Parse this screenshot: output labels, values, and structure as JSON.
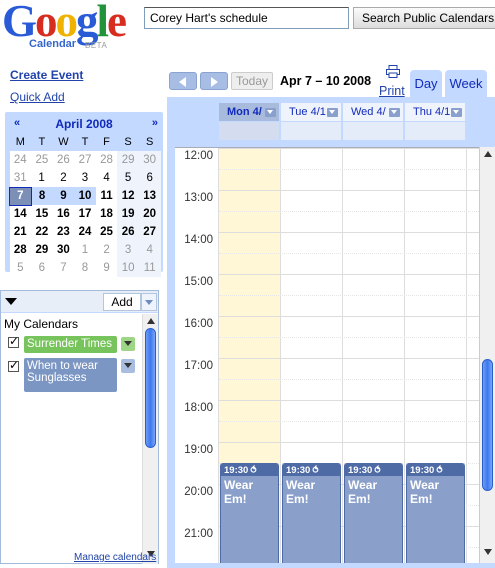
{
  "header": {
    "logo_letters": [
      {
        "ch": "G",
        "color": "#2a5bd7"
      },
      {
        "ch": "o",
        "color": "#d62d20"
      },
      {
        "ch": "o",
        "color": "#f0b200"
      },
      {
        "ch": "g",
        "color": "#2a5bd7"
      },
      {
        "ch": "l",
        "color": "#22933b"
      },
      {
        "ch": "e",
        "color": "#d62d20"
      }
    ],
    "logo_text": "Google",
    "product": "Calendar",
    "beta": "BETA",
    "search_value": "Corey Hart's schedule",
    "search_button": "Search Public Calendars"
  },
  "sidebar": {
    "create_event": "Create Event",
    "quick_add": "Quick Add",
    "mini_cal": {
      "prev": "«",
      "next": "»",
      "title": "April 2008",
      "weekdays": [
        "M",
        "T",
        "W",
        "T",
        "F",
        "S",
        "S"
      ],
      "weeks": [
        [
          "24",
          "25",
          "26",
          "27",
          "28",
          "29",
          "30"
        ],
        [
          "31",
          "1",
          "2",
          "3",
          "4",
          "5",
          "6"
        ],
        [
          "7",
          "8",
          "9",
          "10",
          "11",
          "12",
          "13"
        ],
        [
          "14",
          "15",
          "16",
          "17",
          "18",
          "19",
          "20"
        ],
        [
          "21",
          "22",
          "23",
          "24",
          "25",
          "26",
          "27"
        ],
        [
          "28",
          "29",
          "30",
          "1",
          "2",
          "3",
          "4"
        ],
        [
          "5",
          "6",
          "7",
          "8",
          "9",
          "10",
          "11"
        ]
      ],
      "today": "7"
    },
    "calendars_panel": {
      "add_label": "Add",
      "section_title": "My Calendars",
      "calendars": [
        {
          "name": "Surrender Times",
          "color": "#78c45c",
          "checked": true
        },
        {
          "name": "When to wear Sunglasses",
          "color": "#7b96c3",
          "checked": true
        }
      ],
      "manage_link": "Manage calendars"
    }
  },
  "toolbar": {
    "today": "Today",
    "date_range": "Apr 7 – 10 2008",
    "print": "Print",
    "tabs": [
      "Day",
      "Week"
    ]
  },
  "week": {
    "days": [
      {
        "label": "Mon 4/",
        "is_today": true
      },
      {
        "label": "Tue 4/1",
        "is_today": false
      },
      {
        "label": "Wed 4/",
        "is_today": false
      },
      {
        "label": "Thu 4/1",
        "is_today": false
      }
    ],
    "hours": [
      "12:00",
      "13:00",
      "14:00",
      "15:00",
      "16:00",
      "17:00",
      "18:00",
      "19:00",
      "20:00",
      "21:00"
    ],
    "events": [
      {
        "time": "19:30",
        "title": "Wear Em!"
      },
      {
        "time": "19:30",
        "title": "Wear Em!"
      },
      {
        "time": "19:30",
        "title": "Wear Em!"
      },
      {
        "time": "19:30",
        "title": "Wear Em!"
      }
    ],
    "event_color": "#8aa0cb"
  },
  "colors": {
    "accent": "#c3d9ff",
    "link": "#2244aa",
    "today_column": "#fff7d6"
  }
}
